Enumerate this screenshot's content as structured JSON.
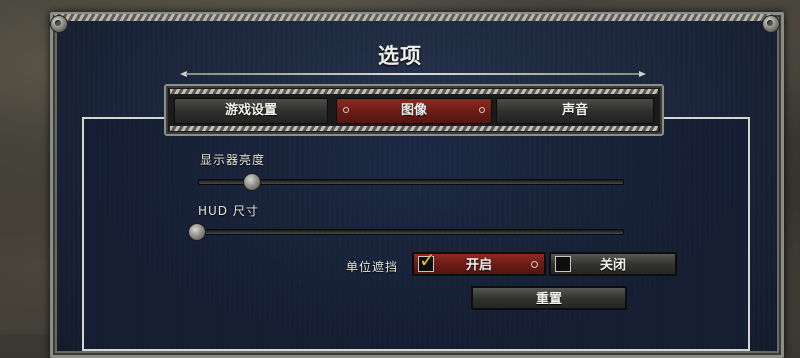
{
  "window": {
    "title": "选项"
  },
  "tabs": [
    {
      "label": "游戏设置",
      "active": false
    },
    {
      "label": "图像",
      "active": true
    },
    {
      "label": "声音",
      "active": false
    }
  ],
  "settings": {
    "brightness": {
      "label": "显示器亮度",
      "value": 0.12
    },
    "hud_size": {
      "label": "HUD 尺寸",
      "value": 0.0
    },
    "unit_occlusion": {
      "label": "单位遮挡",
      "on_label": "开启",
      "off_label": "关闭",
      "selected": "on"
    },
    "reset_label": "重置"
  },
  "colors": {
    "active_tab": "#7a231c",
    "checkmark": "#e7c31b",
    "panel_bg": "#172238"
  }
}
